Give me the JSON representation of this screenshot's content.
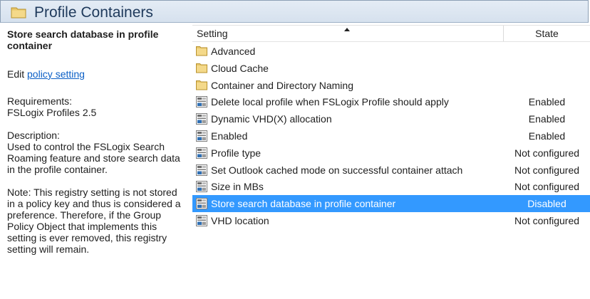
{
  "header": {
    "title": "Profile Containers",
    "icon": "folder-icon"
  },
  "description": {
    "heading": "Store search database in profile container",
    "edit_prefix": "Edit ",
    "edit_link": "policy setting",
    "requirements_label": "Requirements:",
    "requirements_value": "FSLogix Profiles 2.5",
    "description_label": "Description:",
    "description_text": "Used to control the FSLogix Search Roaming feature and store search data in the profile container.",
    "note_text": "Note:  This registry setting is not stored in a policy key and thus is considered a preference.  Therefore, if the Group Policy Object that implements this setting is ever removed, this registry setting will remain."
  },
  "list": {
    "columns": {
      "setting": "Setting",
      "state": "State"
    },
    "sort": "setting-ascending",
    "rows": [
      {
        "name": "Advanced",
        "state": "",
        "icon": "folder-icon",
        "selected": false
      },
      {
        "name": "Cloud Cache",
        "state": "",
        "icon": "folder-icon",
        "selected": false
      },
      {
        "name": "Container and Directory Naming",
        "state": "",
        "icon": "folder-icon",
        "selected": false
      },
      {
        "name": "Delete local profile when FSLogix Profile should apply",
        "state": "Enabled",
        "icon": "policy-setting-icon",
        "selected": false
      },
      {
        "name": "Dynamic VHD(X) allocation",
        "state": "Enabled",
        "icon": "policy-setting-icon",
        "selected": false
      },
      {
        "name": "Enabled",
        "state": "Enabled",
        "icon": "policy-setting-icon",
        "selected": false
      },
      {
        "name": "Profile type",
        "state": "Not configured",
        "icon": "policy-setting-icon",
        "selected": false
      },
      {
        "name": "Set Outlook cached mode on successful container attach",
        "state": "Not configured",
        "icon": "policy-setting-icon",
        "selected": false
      },
      {
        "name": "Size in MBs",
        "state": "Not configured",
        "icon": "policy-setting-icon",
        "selected": false
      },
      {
        "name": "Store search database in profile container",
        "state": "Disabled",
        "icon": "policy-setting-icon",
        "selected": true
      },
      {
        "name": "VHD location",
        "state": "Not configured",
        "icon": "policy-setting-icon",
        "selected": false
      }
    ]
  },
  "colors": {
    "selection": "#3399ff",
    "link": "#0b5fc6",
    "header_title": "#1e395b"
  }
}
